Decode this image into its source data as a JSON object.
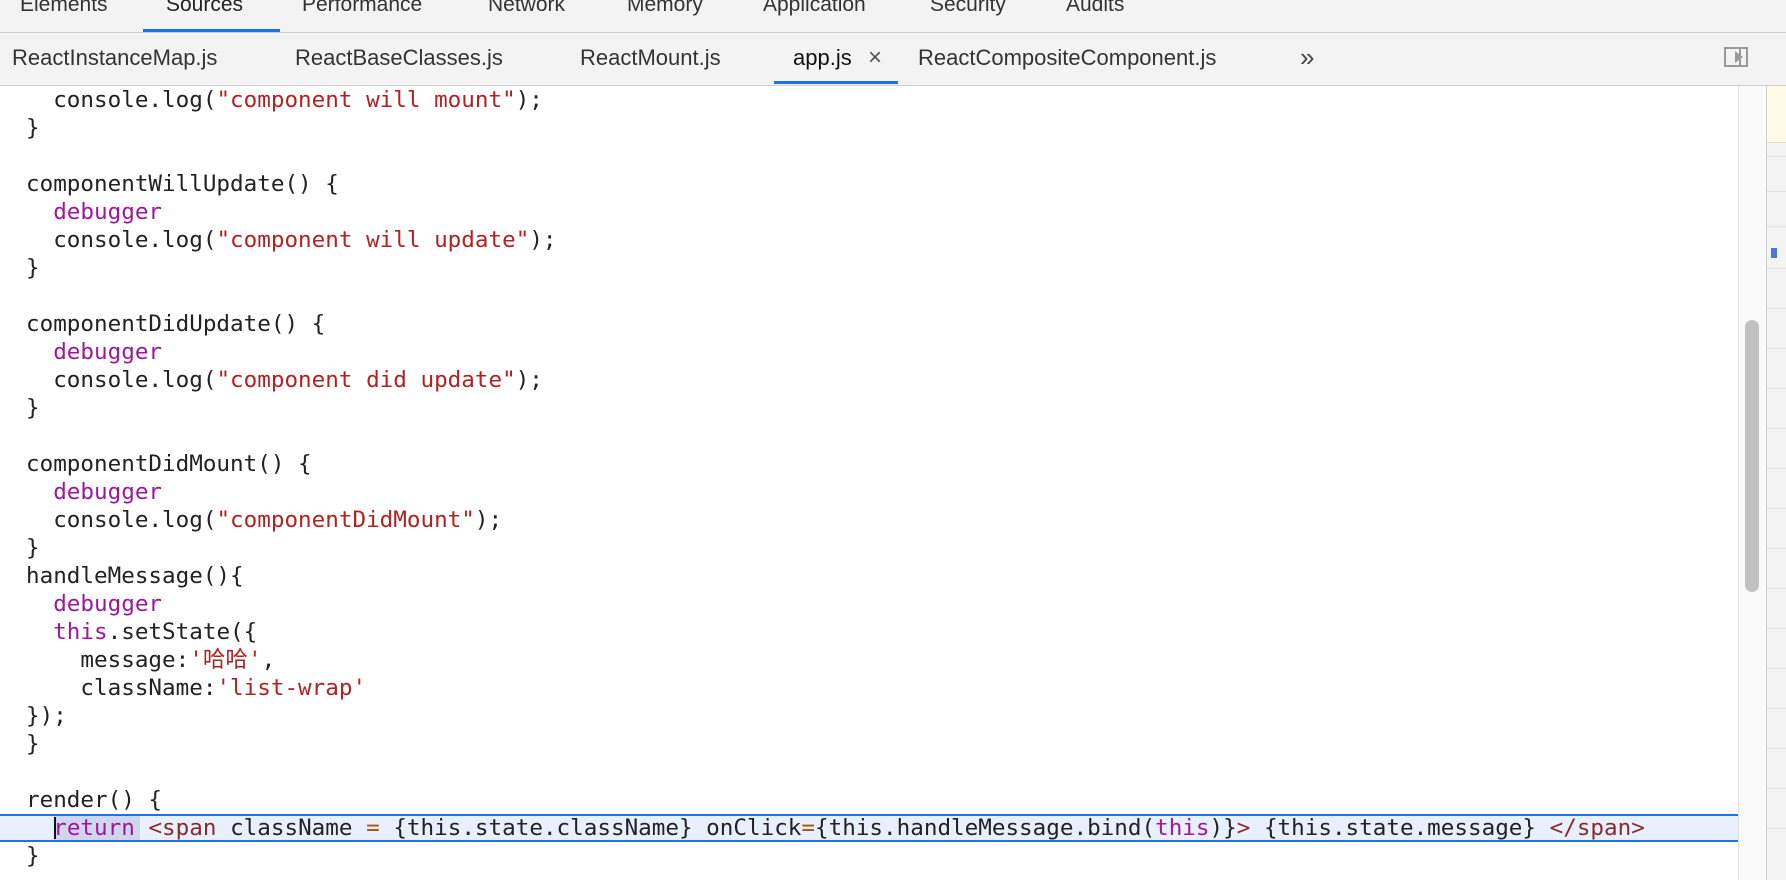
{
  "panel_tabs": [
    {
      "label": "Elements"
    },
    {
      "label": "Sources",
      "active": true
    },
    {
      "label": "Performance"
    },
    {
      "label": "Network"
    },
    {
      "label": "Memory"
    },
    {
      "label": "Application"
    },
    {
      "label": "Security"
    },
    {
      "label": "Audits"
    }
  ],
  "file_tabs": [
    {
      "label": "ReactInstanceMap.js"
    },
    {
      "label": "ReactBaseClasses.js"
    },
    {
      "label": "ReactMount.js"
    },
    {
      "label": "app.js",
      "active": true,
      "closable": true
    },
    {
      "label": "ReactCompositeComponent.js"
    }
  ],
  "file_tabs_more": "»",
  "close_glyph": "×",
  "code": {
    "l1": "  console.log(",
    "l1s": "\"component will mount\"",
    "l1e": ");",
    "l2": "}",
    "l4": "componentWillUpdate() {",
    "l5": "  debugger",
    "l6": "  console.log(",
    "l6s": "\"component will update\"",
    "l6e": ");",
    "l7": "}",
    "l9": "componentDidUpdate() {",
    "l10": "  debugger",
    "l11": "  console.log(",
    "l11s": "\"component did update\"",
    "l11e": ");",
    "l12": "}",
    "l14": "componentDidMount() {",
    "l15": "  debugger",
    "l16": "  console.log(",
    "l16s": "\"componentDidMount\"",
    "l16e": ");",
    "l17": "}",
    "l18": "handleMessage(){",
    "l19": "  debugger",
    "l20k": "  this",
    "l20": ".setState({",
    "l21": "    message:",
    "l21s": "'哈哈'",
    "l21e": ",",
    "l22": "    className:",
    "l22s": "'list-wrap'",
    "l23": "});",
    "l24": "}",
    "l26": "render() {",
    "l27a": "  ",
    "l27k": "return",
    "l27b": " ",
    "l27t1": "<span",
    "l27c": " className ",
    "l27eq": "=",
    "l27d": " {this.state.className} onClick",
    "l27eq2": "=",
    "l27e": "{this.handleMessage.bind(",
    "l27this": "this",
    "l27f": ")}",
    "l27t2": ">",
    "l27g": " {this.state.message} ",
    "l27t3": "</span>",
    "l28": "}"
  }
}
